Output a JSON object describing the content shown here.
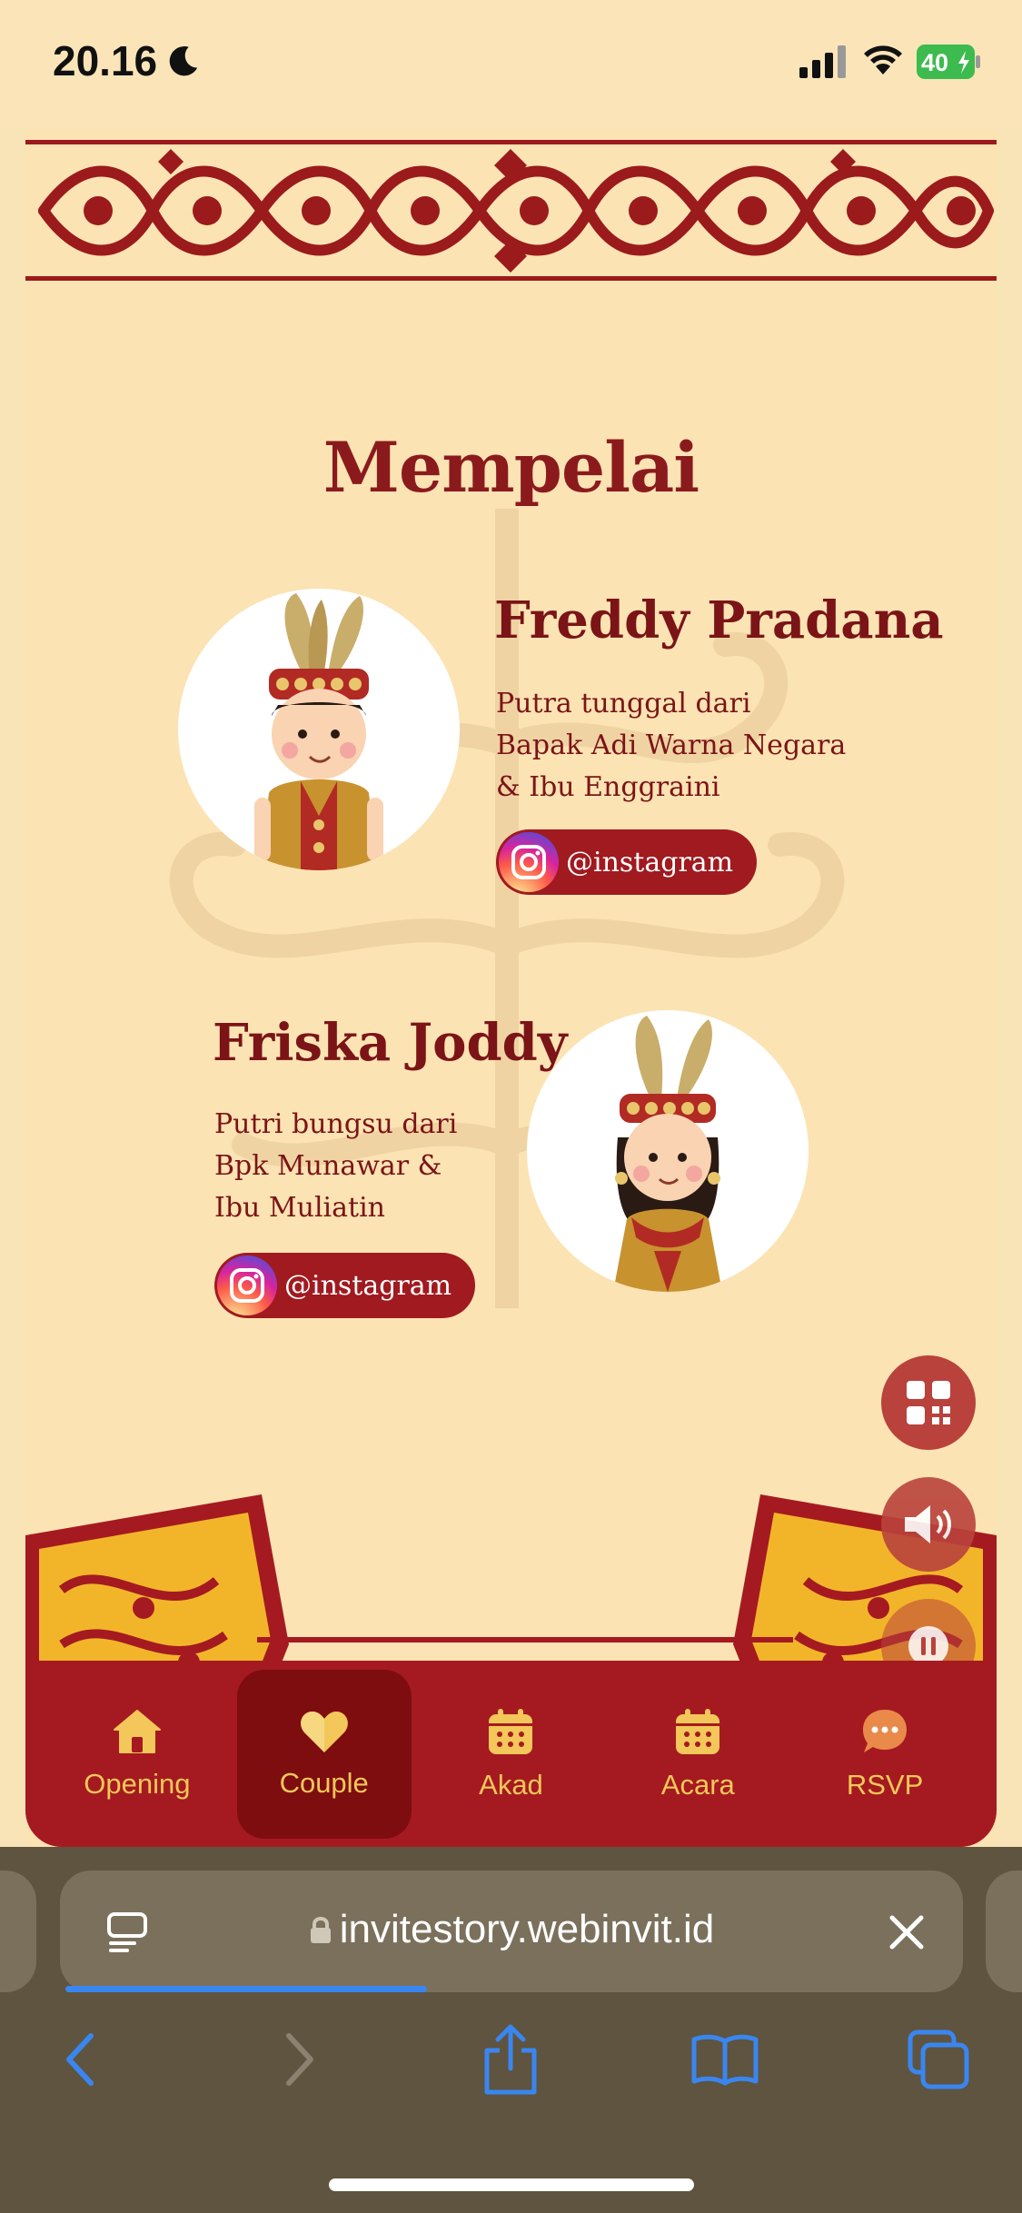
{
  "status_bar": {
    "time": "20.16",
    "battery": "40"
  },
  "page": {
    "section_title": "Mempelai",
    "groom": {
      "name": "Freddy Pradana",
      "parents_line1": "Putra tunggal dari",
      "parents_line2": "Bapak Adi Warna Negara",
      "parents_line3": "& Ibu Enggraini",
      "instagram": "@instagram"
    },
    "bride": {
      "name": "Friska Joddy",
      "parents_line1": "Putri bungsu dari",
      "parents_line2": "Bpk Munawar &",
      "parents_line3": "Ibu Muliatin",
      "instagram": "@instagram"
    }
  },
  "nav": {
    "items": [
      {
        "label": "Opening",
        "icon": "home-icon"
      },
      {
        "label": "Couple",
        "icon": "heart-icon",
        "active": true
      },
      {
        "label": "Akad",
        "icon": "calendar-icon"
      },
      {
        "label": "Acara",
        "icon": "calendar-icon"
      },
      {
        "label": "RSVP",
        "icon": "chat-icon"
      }
    ]
  },
  "browser": {
    "url": "invitestory.webinvit.id",
    "load_progress": 0.4
  },
  "colors": {
    "background": "#f8e4b6",
    "primary_red": "#a51a20",
    "accent_gold": "#f3c75a",
    "text_maroon": "#7b1417"
  }
}
